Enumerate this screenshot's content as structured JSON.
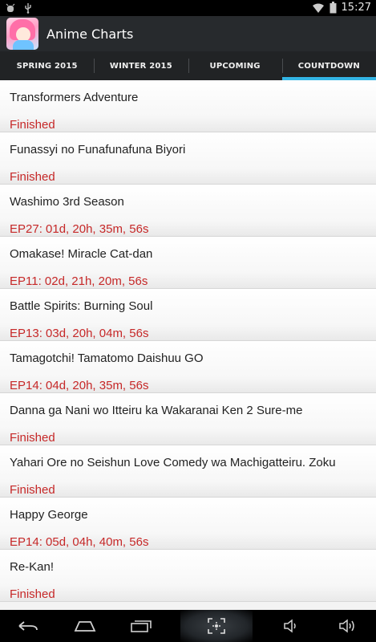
{
  "status_bar": {
    "time": "15:27",
    "icons": [
      "debug-icon",
      "usb-icon",
      "wifi-icon",
      "battery-icon"
    ]
  },
  "app": {
    "title": "Anime Charts",
    "icon": "app-icon"
  },
  "tabs": [
    {
      "label": "SPRING 2015",
      "active": false
    },
    {
      "label": "WINTER 2015",
      "active": false
    },
    {
      "label": "UPCOMING",
      "active": false
    },
    {
      "label": "COUNTDOWN",
      "active": true
    }
  ],
  "accent_color": "#33b5e5",
  "status_color": "#c62828",
  "items": [
    {
      "title": "Transformers Adventure",
      "status": "Finished"
    },
    {
      "title": "Funassyi no Funafunafuna Biyori",
      "status": "Finished"
    },
    {
      "title": "Washimo 3rd Season",
      "status": "EP27: 01d, 20h, 35m, 56s"
    },
    {
      "title": "Omakase! Miracle Cat-dan",
      "status": "EP11: 02d, 21h, 20m, 56s"
    },
    {
      "title": "Battle Spirits: Burning Soul",
      "status": "EP13: 03d, 20h, 04m, 56s"
    },
    {
      "title": "Tamagotchi! Tamatomo Daishuu GO",
      "status": "EP14: 04d, 20h, 35m, 56s"
    },
    {
      "title": "Danna ga Nani wo Itteiru ka Wakaranai Ken 2 Sure-me",
      "status": "Finished"
    },
    {
      "title": "Yahari Ore no Seishun Love Comedy wa Machigatteiru. Zoku",
      "status": "Finished"
    },
    {
      "title": "Happy George",
      "status": "EP14: 05d, 04h, 40m, 56s"
    },
    {
      "title": "Re-Kan!",
      "status": "Finished"
    }
  ],
  "nav_bar": {
    "buttons": [
      "back-icon",
      "home-icon",
      "recent-apps-icon",
      "screenshot-icon",
      "volume-down-icon",
      "volume-up-icon"
    ]
  }
}
